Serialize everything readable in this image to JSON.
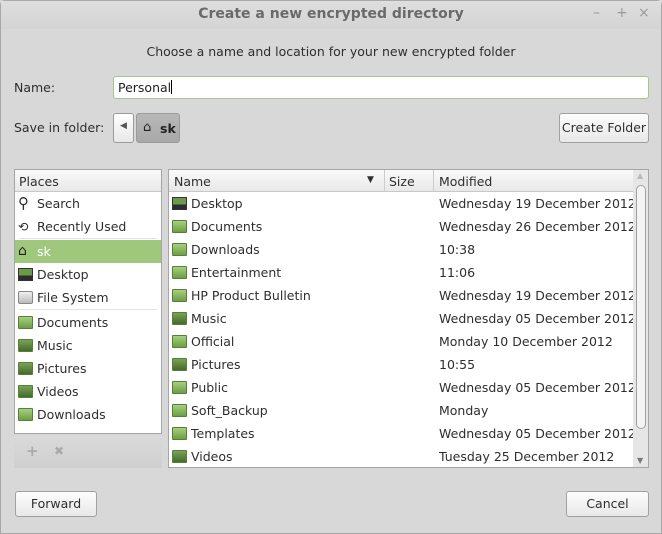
{
  "window": {
    "title": "Create a new encrypted directory",
    "subtitle": "Choose a name and location for your new encrypted folder",
    "controls": [
      "–",
      "+",
      "×"
    ]
  },
  "name_field": {
    "label": "Name:",
    "value": "Personal"
  },
  "save_in": {
    "label": "Save in folder:",
    "current": "sk",
    "create_folder": "Create Folder"
  },
  "places": {
    "header": "Places",
    "items": [
      {
        "label": "Search",
        "icon": "search-icon"
      },
      {
        "label": "Recently Used",
        "icon": "history-icon"
      },
      {
        "label": "sk",
        "icon": "home-icon",
        "selected": true
      },
      {
        "label": "Desktop",
        "icon": "desktop-icon"
      },
      {
        "label": "File System",
        "icon": "drive-icon"
      },
      {
        "label": "Documents",
        "icon": "folder-documents-icon"
      },
      {
        "label": "Music",
        "icon": "folder-music-icon"
      },
      {
        "label": "Pictures",
        "icon": "folder-pictures-icon"
      },
      {
        "label": "Videos",
        "icon": "folder-videos-icon"
      },
      {
        "label": "Downloads",
        "icon": "folder-downloads-icon"
      }
    ],
    "add": "+",
    "remove": "✖"
  },
  "files": {
    "columns": [
      "Name",
      "Size",
      "Modified"
    ],
    "rows": [
      {
        "name": "Desktop",
        "size": "",
        "modified": "Wednesday 19 December 2012"
      },
      {
        "name": "Documents",
        "size": "",
        "modified": "Wednesday 26 December 2012"
      },
      {
        "name": "Downloads",
        "size": "",
        "modified": "10:38"
      },
      {
        "name": "Entertainment",
        "size": "",
        "modified": "11:06"
      },
      {
        "name": "HP Product Bulletin",
        "size": "",
        "modified": "Wednesday 19 December 2012"
      },
      {
        "name": "Music",
        "size": "",
        "modified": "Wednesday 05 December 2012"
      },
      {
        "name": "Official",
        "size": "",
        "modified": "Monday 10 December 2012"
      },
      {
        "name": "Pictures",
        "size": "",
        "modified": "10:55"
      },
      {
        "name": "Public",
        "size": "",
        "modified": "Wednesday 05 December 2012"
      },
      {
        "name": "Soft_Backup",
        "size": "",
        "modified": "Monday"
      },
      {
        "name": "Templates",
        "size": "",
        "modified": "Wednesday 05 December 2012"
      },
      {
        "name": "Videos",
        "size": "",
        "modified": "Tuesday 25 December 2012"
      }
    ]
  },
  "buttons": {
    "forward": "Forward",
    "cancel": "Cancel"
  },
  "colors": {
    "selection": "#9fc87c",
    "folder": "#8cbc62"
  }
}
